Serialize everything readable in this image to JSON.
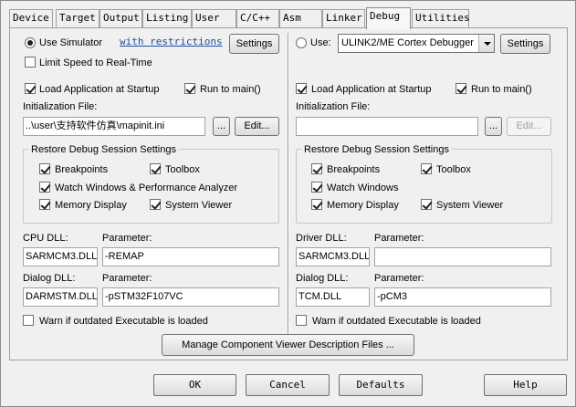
{
  "tabs": [
    {
      "label": "Device",
      "active": false
    },
    {
      "label": "Target",
      "active": false
    },
    {
      "label": "Output",
      "active": false
    },
    {
      "label": "Listing",
      "active": false
    },
    {
      "label": "User",
      "active": false
    },
    {
      "label": "C/C++",
      "active": false
    },
    {
      "label": "Asm",
      "active": false
    },
    {
      "label": "Linker",
      "active": false
    },
    {
      "label": "Debug",
      "active": true
    },
    {
      "label": "Utilities",
      "active": false
    }
  ],
  "left": {
    "use_simulator": {
      "label": "Use Simulator",
      "selected": true
    },
    "restrictions_link": "with restrictions",
    "settings_label": "Settings",
    "limit_speed": {
      "label": "Limit Speed to Real-Time",
      "checked": false
    },
    "load_app": {
      "label": "Load Application at Startup",
      "checked": true
    },
    "run_to_main": {
      "label": "Run to main()",
      "checked": true
    },
    "init_file_label": "Initialization File:",
    "init_file_value": "..\\user\\支持软件仿真\\mapinit.ini",
    "browse_label": "...",
    "edit_label": "Edit...",
    "restore_title": "Restore Debug Session Settings",
    "breakpoints": {
      "label": "Breakpoints",
      "checked": true
    },
    "toolbox": {
      "label": "Toolbox",
      "checked": true
    },
    "watch_windows": {
      "label": "Watch Windows & Performance Analyzer",
      "checked": true
    },
    "memory_display": {
      "label": "Memory Display",
      "checked": true
    },
    "system_viewer": {
      "label": "System Viewer",
      "checked": true
    },
    "dll_label": "CPU DLL:",
    "param_label": "Parameter:",
    "dll_value": "SARMCM3.DLL",
    "dll_param": "-REMAP",
    "dialog_dll_label": "Dialog DLL:",
    "dialog_param_label": "Parameter:",
    "dialog_dll_value": "DARMSTM.DLL",
    "dialog_param": "-pSTM32F107VC",
    "warn": {
      "label": "Warn if outdated Executable is loaded",
      "checked": false
    }
  },
  "right": {
    "use": {
      "label": "Use:",
      "selected": false
    },
    "debugger_value": "ULINK2/ME Cortex Debugger",
    "settings_label": "Settings",
    "load_app": {
      "label": "Load Application at Startup",
      "checked": true
    },
    "run_to_main": {
      "label": "Run to main()",
      "checked": true
    },
    "init_file_label": "Initialization File:",
    "init_file_value": "",
    "browse_label": "...",
    "edit_label": "Edit...",
    "restore_title": "Restore Debug Session Settings",
    "breakpoints": {
      "label": "Breakpoints",
      "checked": true
    },
    "toolbox": {
      "label": "Toolbox",
      "checked": true
    },
    "watch_windows": {
      "label": "Watch Windows",
      "checked": true
    },
    "memory_display": {
      "label": "Memory Display",
      "checked": true
    },
    "system_viewer": {
      "label": "System Viewer",
      "checked": true
    },
    "dll_label": "Driver DLL:",
    "param_label": "Parameter:",
    "dll_value": "SARMCM3.DLL",
    "dll_param": "",
    "dialog_dll_label": "Dialog DLL:",
    "dialog_param_label": "Parameter:",
    "dialog_dll_value": "TCM.DLL",
    "dialog_param": "-pCM3",
    "warn": {
      "label": "Warn if outdated Executable is loaded",
      "checked": false
    }
  },
  "manage_button": "Manage Component Viewer Description Files ...",
  "footer": {
    "ok": "OK",
    "cancel": "Cancel",
    "defaults": "Defaults",
    "help": "Help"
  }
}
